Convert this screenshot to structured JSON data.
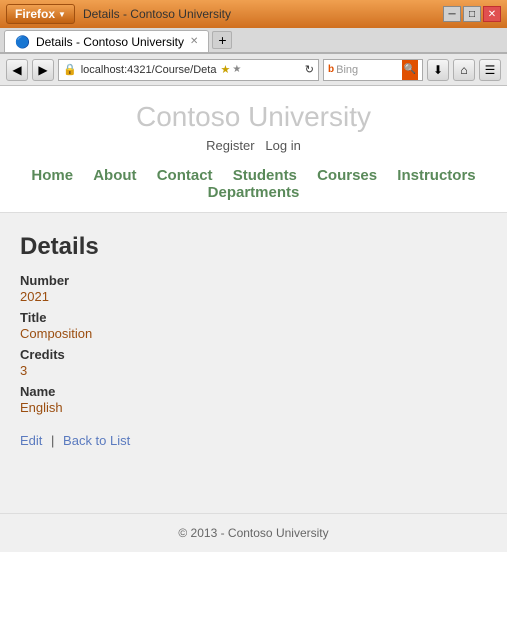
{
  "window": {
    "title": "Details - Contoso University",
    "url": "localhost:4321/Course/Deta",
    "search_placeholder": "Bing"
  },
  "header": {
    "site_title": "Contoso University",
    "auth": {
      "register": "Register",
      "login": "Log in"
    },
    "nav": [
      "Home",
      "About",
      "Contact",
      "Students",
      "Courses",
      "Instructors",
      "Departments"
    ]
  },
  "content": {
    "page_title": "Details",
    "fields": [
      {
        "label": "Number",
        "value": "2021"
      },
      {
        "label": "Title",
        "value": "Composition"
      },
      {
        "label": "Credits",
        "value": "3"
      },
      {
        "label": "Name",
        "value": "English"
      }
    ],
    "actions": {
      "edit": "Edit",
      "back": "Back to List"
    }
  },
  "footer": {
    "text": "© 2013 - Contoso University"
  },
  "nav_buttons": {
    "back": "◀",
    "forward": "▶",
    "reload": "↻",
    "home": "⌂",
    "menu": "☰"
  }
}
